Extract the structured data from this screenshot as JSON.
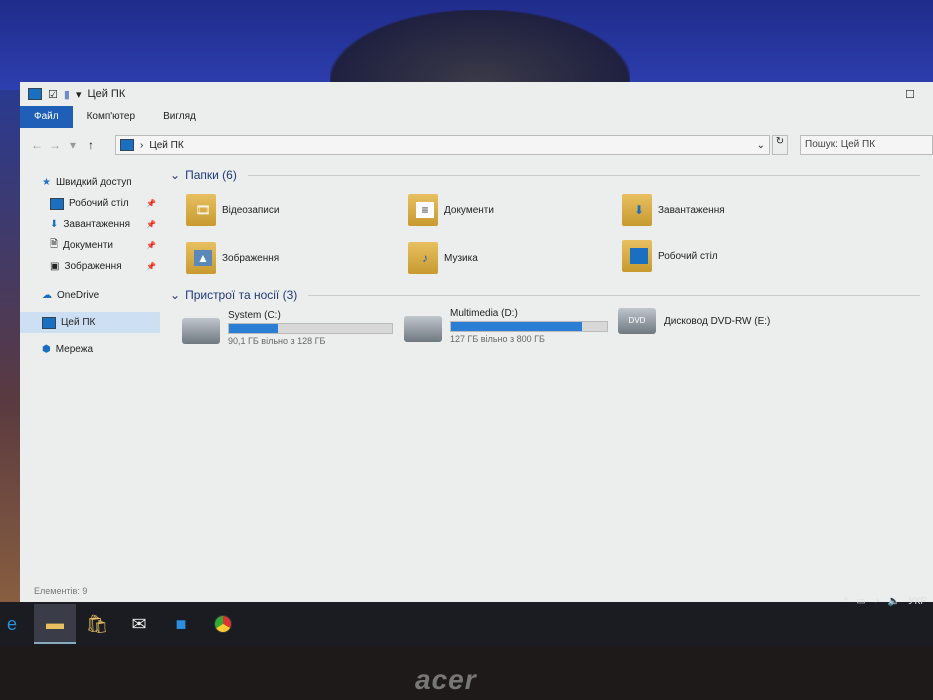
{
  "window": {
    "title": "Цей ПК"
  },
  "ribbon": {
    "tabs": [
      "Файл",
      "Комп'ютер",
      "Вигляд"
    ]
  },
  "address": {
    "path": "Цей ПК",
    "search_placeholder": "Пошук: Цей ПК"
  },
  "sidebar": {
    "items": [
      {
        "label": "Швидкий доступ",
        "icon": "star-icon"
      },
      {
        "label": "Робочий стіл",
        "icon": "desktop-icon",
        "pinned": true
      },
      {
        "label": "Завантаження",
        "icon": "download-icon",
        "pinned": true
      },
      {
        "label": "Документи",
        "icon": "document-icon",
        "pinned": true
      },
      {
        "label": "Зображення",
        "icon": "picture-icon",
        "pinned": true
      },
      {
        "label": "OneDrive",
        "icon": "cloud-icon"
      },
      {
        "label": "Цей ПК",
        "icon": "computer-icon",
        "selected": true
      },
      {
        "label": "Мережа",
        "icon": "network-icon"
      }
    ]
  },
  "folders": {
    "header": "Папки (6)",
    "items": [
      "Відеозаписи",
      "Документи",
      "Завантаження",
      "Зображення",
      "Музика",
      "Робочий стіл"
    ]
  },
  "devices": {
    "header": "Пристрої та носії (3)",
    "items": [
      {
        "name": "System (C:)",
        "free": "90,1 ГБ вільно з 128 ГБ",
        "used_percent": 30
      },
      {
        "name": "Multimedia (D:)",
        "free": "127 ГБ вільно з 800 ГБ",
        "used_percent": 84
      },
      {
        "name": "Дисковод DVD-RW (E:)"
      }
    ]
  },
  "status": {
    "items": "Елементів: 9"
  },
  "taskbar": {
    "lang": "УКР"
  },
  "bezel": {
    "logo": "acer"
  }
}
